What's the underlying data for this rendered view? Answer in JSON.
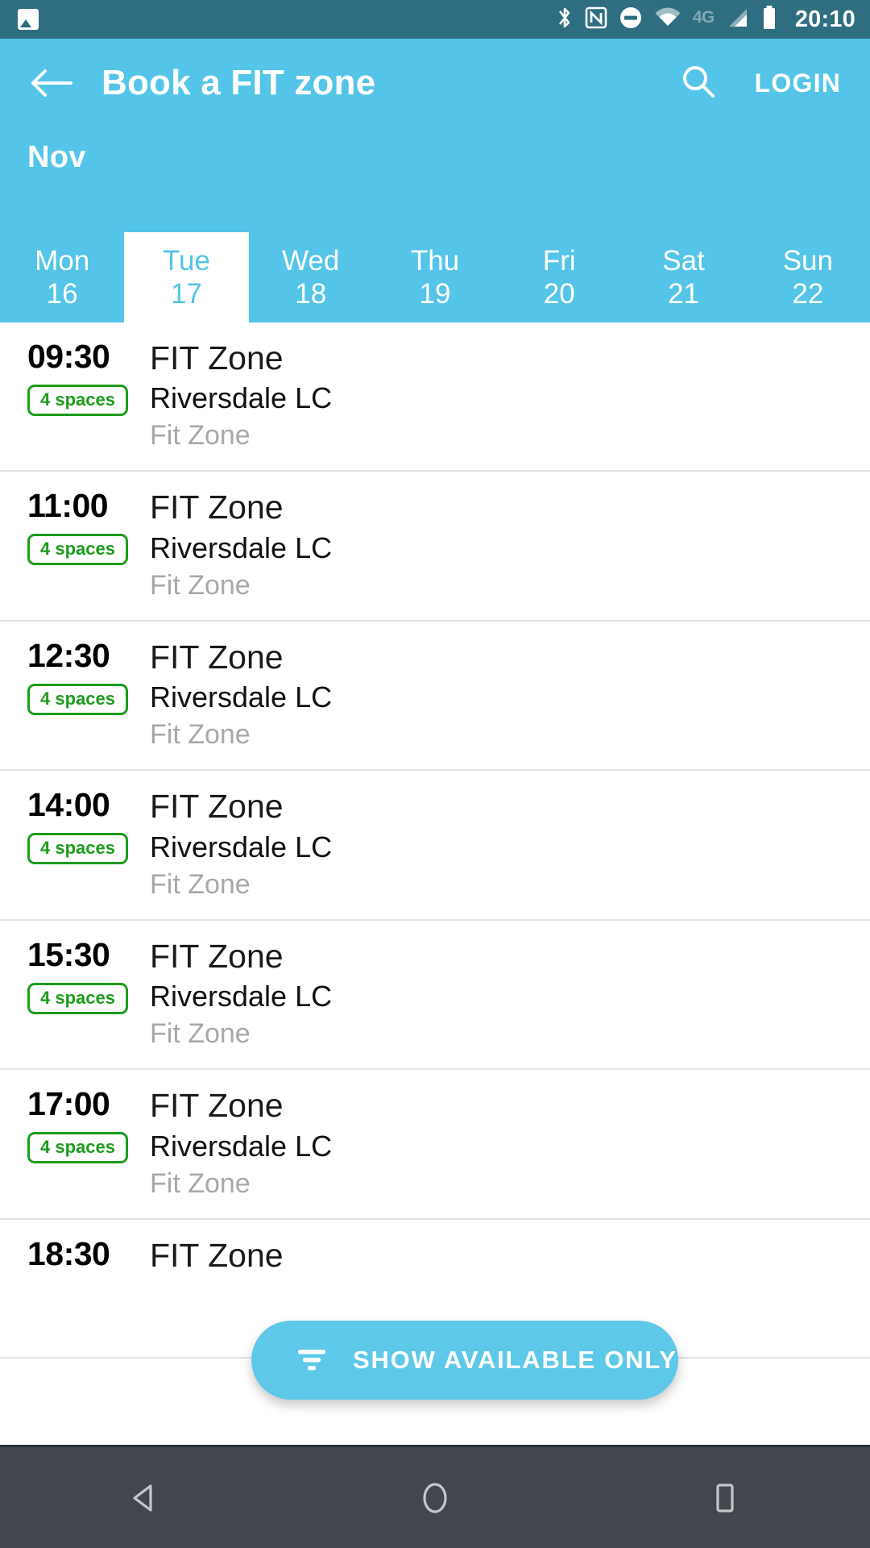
{
  "status_bar": {
    "time": "20:10",
    "network_label": "4G",
    "icons": [
      "image-icon",
      "bluetooth-icon",
      "nfc-icon",
      "do-not-disturb-icon",
      "wifi-icon",
      "cellular-signal-icon",
      "battery-icon"
    ],
    "background_color": "#2e6e80"
  },
  "app_bar": {
    "title": "Book a FIT zone",
    "back_icon": "back-arrow-icon",
    "search_icon": "search-icon",
    "login_label": "LOGIN",
    "background_color": "#54c5e8"
  },
  "calendar": {
    "month": "Nov",
    "days": [
      {
        "dow": "Mon",
        "date": "16",
        "selected": false
      },
      {
        "dow": "Tue",
        "date": "17",
        "selected": true
      },
      {
        "dow": "Wed",
        "date": "18",
        "selected": false
      },
      {
        "dow": "Thu",
        "date": "19",
        "selected": false
      },
      {
        "dow": "Fri",
        "date": "20",
        "selected": false
      },
      {
        "dow": "Sat",
        "date": "21",
        "selected": false
      },
      {
        "dow": "Sun",
        "date": "22",
        "selected": false
      }
    ]
  },
  "sessions": [
    {
      "time": "09:30",
      "spaces": "4 spaces",
      "name": "FIT Zone",
      "venue": "Riversdale LC",
      "zone": "Fit Zone"
    },
    {
      "time": "11:00",
      "spaces": "4 spaces",
      "name": "FIT Zone",
      "venue": "Riversdale LC",
      "zone": "Fit Zone"
    },
    {
      "time": "12:30",
      "spaces": "4 spaces",
      "name": "FIT Zone",
      "venue": "Riversdale LC",
      "zone": "Fit Zone"
    },
    {
      "time": "14:00",
      "spaces": "4 spaces",
      "name": "FIT Zone",
      "venue": "Riversdale LC",
      "zone": "Fit Zone"
    },
    {
      "time": "15:30",
      "spaces": "4 spaces",
      "name": "FIT Zone",
      "venue": "Riversdale LC",
      "zone": "Fit Zone"
    },
    {
      "time": "17:00",
      "spaces": "4 spaces",
      "name": "FIT Zone",
      "venue": "Riversdale LC",
      "zone": "Fit Zone"
    },
    {
      "time": "18:30",
      "spaces": "",
      "name": "FIT Zone",
      "venue": "",
      "zone": ""
    }
  ],
  "fab": {
    "label": "SHOW AVAILABLE ONLY",
    "icon": "filter-icon",
    "background_color": "#5ec8e8"
  },
  "nav_bar": {
    "back_icon": "nav-back-triangle-icon",
    "home_icon": "nav-home-circle-icon",
    "recents_icon": "nav-recents-square-icon",
    "background_color": "#41474c"
  },
  "colors": {
    "primary": "#54c5e8",
    "status_bar": "#2e6e80",
    "badge_green": "#1c9c1c",
    "muted_text": "#a8a8a8"
  }
}
